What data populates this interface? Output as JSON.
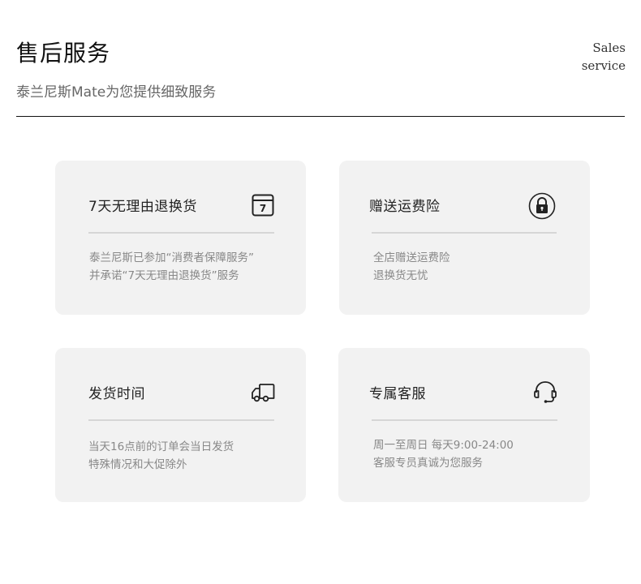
{
  "header": {
    "title": "售后服务",
    "subtitle": "泰兰尼斯Mate为您提供细致服务",
    "en_line1": "Sales",
    "en_line2": "service"
  },
  "cards": [
    {
      "title": "7天无理由退换货",
      "icon": "calendar-7-icon",
      "icon_text": "7",
      "desc_line1": "泰兰尼斯已参加“消费者保障服务”",
      "desc_line2": "并承诺“7天无理由退换货”服务"
    },
    {
      "title": "赠送运费险",
      "icon": "lock-icon",
      "desc_line1": "全店赠送运费险",
      "desc_line2": "退换货无忧"
    },
    {
      "title": "发货时间",
      "icon": "delivery-truck-icon",
      "desc_line1": "当天16点前的订单会当日发货",
      "desc_line2": "特殊情况和大促除外"
    },
    {
      "title": "专属客服",
      "icon": "headset-icon",
      "desc_line1": "周一至周日  每天9:00-24:00",
      "desc_line2": "客服专员真诚为您服务"
    }
  ],
  "colors": {
    "card_bg": "#f2f2f2",
    "rule": "#111111",
    "desc_text": "#888888"
  }
}
